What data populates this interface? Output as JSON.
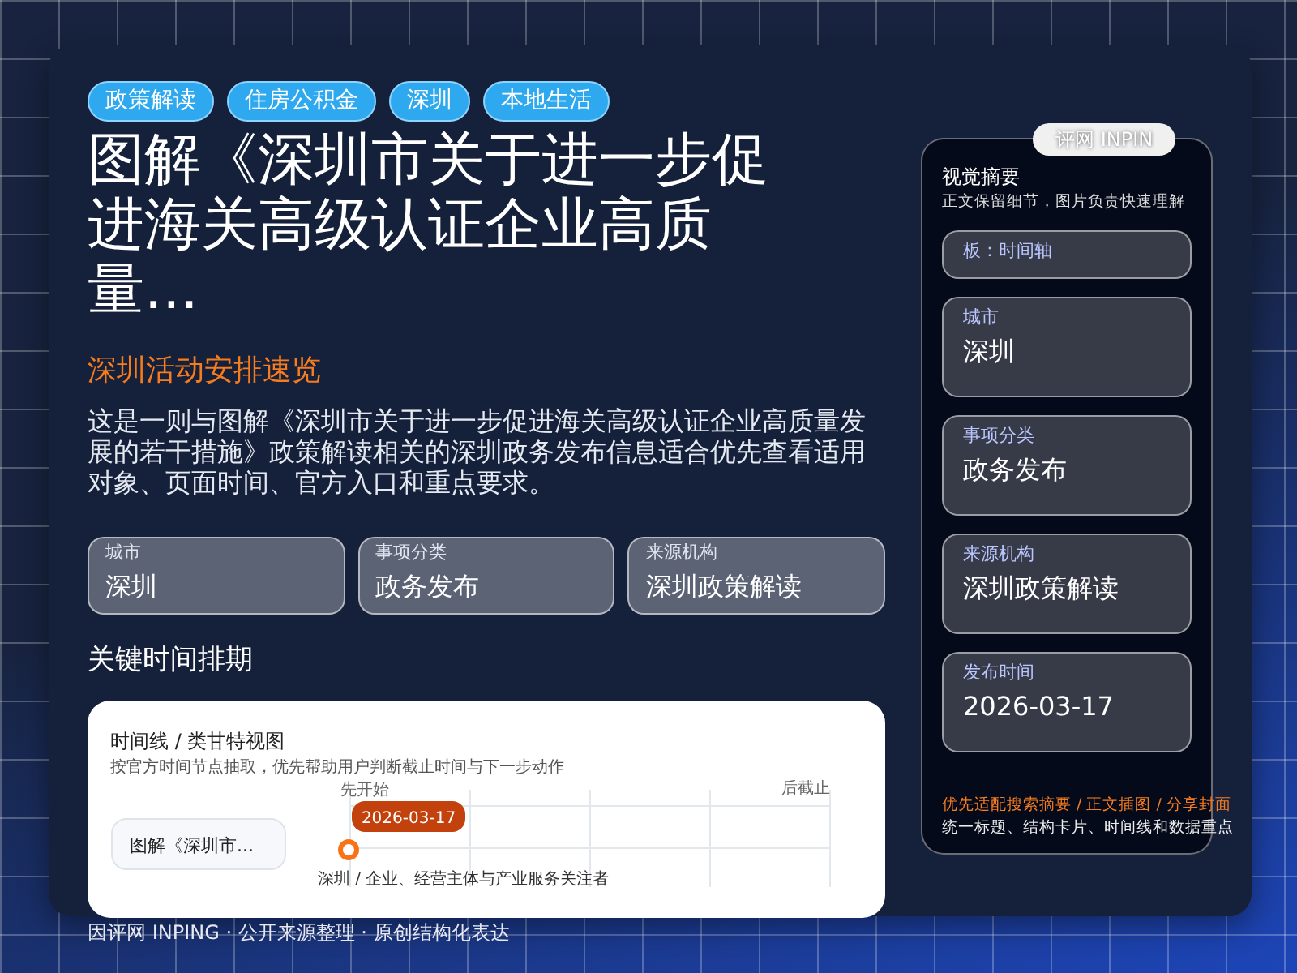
{
  "tags": [
    "政策解读",
    "住房公积金",
    "深圳",
    "本地生活"
  ],
  "title": "图解《深圳市关于进一步促进海关高级认证企业高质量...",
  "subtitle": "深圳活动安排速览",
  "description": "这是一则与图解《深圳市关于进一步促进海关高级认证企业高质量发展的若干措施》政策解读相关的深圳政务发布信息适合优先查看适用对象、页面时间、官方入口和重点要求。",
  "facts": [
    {
      "label": "城市",
      "value": "深圳"
    },
    {
      "label": "事项分类",
      "value": "政务发布"
    },
    {
      "label": "来源机构",
      "value": "深圳政策解读"
    }
  ],
  "section_title": "关键时间排期",
  "timeline": {
    "title": "时间线 / 类甘特视图",
    "subtitle": "按官方时间节点抽取，优先帮助用户判断截止时间与下一步动作",
    "start_label": "先开始",
    "end_label": "后截止",
    "row_label": "图解《深圳市...",
    "date": "2026-03-17",
    "note": "深圳 / 企业、经营主体与产业服务关注者"
  },
  "footer": "因评网 INPING · 公开来源整理 · 原创结构化表达",
  "side_panel": {
    "badge": "评网 INPIN",
    "title": "视觉摘要",
    "subtitle": "正文保留细节，图片负责快速理解",
    "template": "板：时间轴",
    "cards": [
      {
        "label": "城市",
        "value": "深圳"
      },
      {
        "label": "事项分类",
        "value": "政务发布"
      },
      {
        "label": "来源机构",
        "value": "深圳政策解读"
      },
      {
        "label": "发布时间",
        "value": "2026-03-17"
      }
    ],
    "highlight": "优先适配搜索摘要 / 正文插图 / 分享封面",
    "note": "统一标题、结构卡片、时间线和数据重点"
  }
}
